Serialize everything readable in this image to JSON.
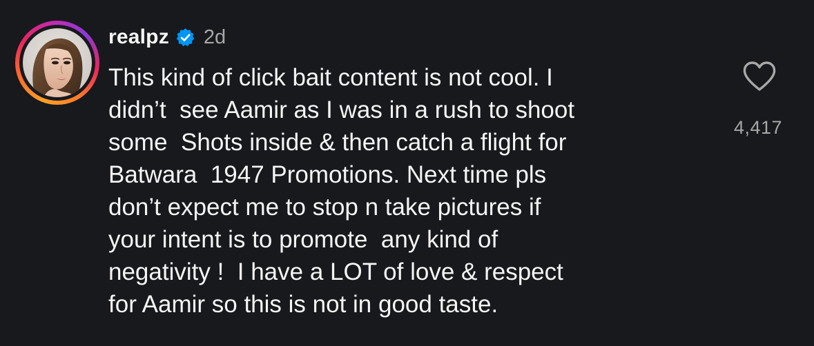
{
  "comment": {
    "username": "realpz",
    "verified_icon": "verified-badge-icon",
    "time_ago": "2d",
    "lines": [
      "This kind of click bait content is not cool. I",
      "didn’t  see Aamir as I was in a rush to shoot",
      "some  Shots inside & then catch a flight for",
      "Batwara  1947 Promotions. Next time pls",
      "don’t expect me to stop n take pictures if",
      "your intent is to promote  any kind of",
      "negativity !  I have a LOT of love & respect",
      "for Aamir so this is not in good taste."
    ],
    "like_icon": "heart-outline-icon",
    "like_count": "4,417"
  },
  "colors": {
    "background": "#17191d",
    "text": "#f5f5f5",
    "secondary_text": "#a8a8a8",
    "verified_blue": "#0095f6"
  }
}
